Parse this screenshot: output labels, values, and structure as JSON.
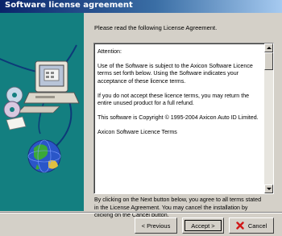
{
  "window": {
    "title": "Software license agreement"
  },
  "prompt": "Please read the following License Agreement.",
  "license": {
    "paragraphs": [
      "Attention:",
      "Use of the Software is subject to the Axicon Software Licence terms set forth below. Using the Software indicates your acceptance of these licence terms.",
      "If you do not accept these licence terms, you may return the entire unused product for a full refund.",
      "This software is Copyright © 1995-2004 Axicon Auto ID Limited.",
      "Axicon Software Licence Terms"
    ]
  },
  "notice": {
    "lines": [
      "By clicking on the Next button below, you agree to all terms stated",
      "in the License Agreement. You may cancel the installation by",
      "clicking on the Cancel button."
    ]
  },
  "buttons": {
    "previous": "< Previous",
    "accept": "Accept >",
    "cancel": "Cancel"
  },
  "icons": {
    "art": "computer-cd-globe-illustration",
    "cancel": "red-x-icon"
  },
  "colors": {
    "title_bar": "#0a246a",
    "art_background": "#137f80",
    "dialog_background": "#d4d0c8"
  }
}
